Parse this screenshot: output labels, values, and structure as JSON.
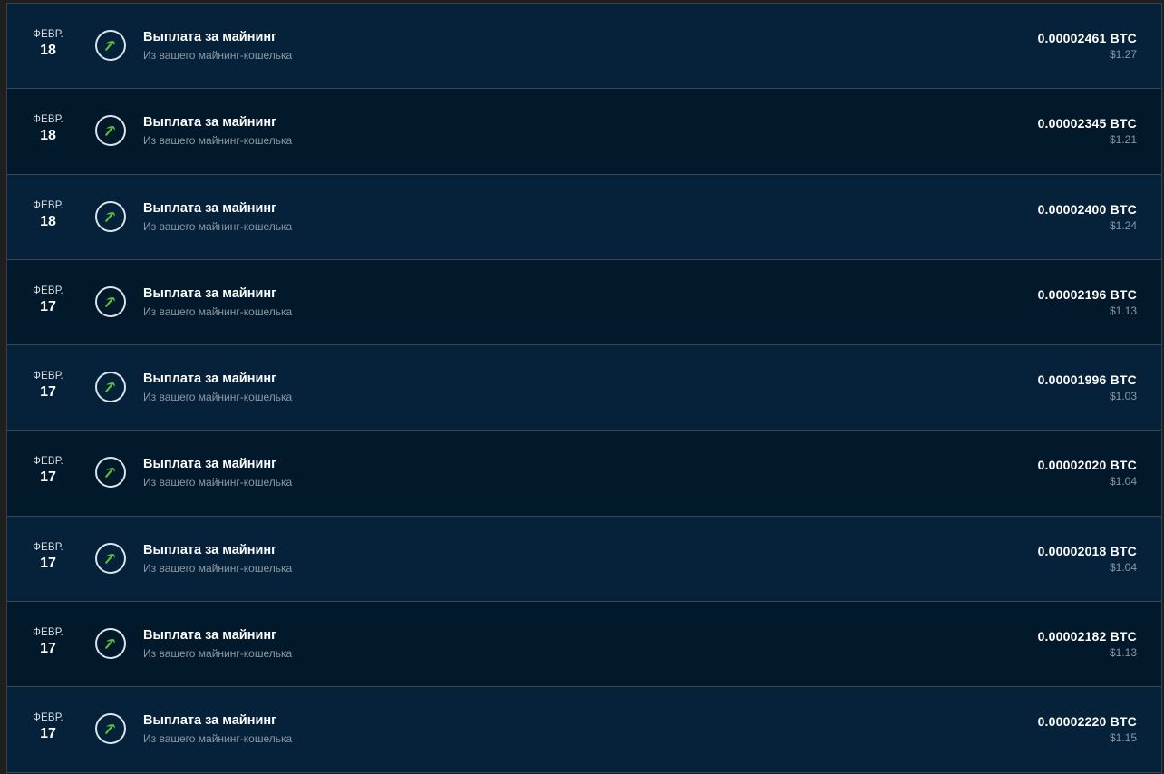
{
  "colors": {
    "row_odd": "#05223a",
    "row_even": "#02182b",
    "icon_accent": "#5fc13b",
    "icon_ring": "#dbe4ea",
    "title_text": "#ffffff",
    "muted_text": "#8c98a3"
  },
  "transactions": [
    {
      "month": "ФЕВР.",
      "day": "18",
      "title": "Выплата за майнинг",
      "subtitle": "Из вашего майнинг-кошелька",
      "btc": "0.00002461 BTC",
      "usd": "$1.27",
      "icon": "pickaxe-icon"
    },
    {
      "month": "ФЕВР.",
      "day": "18",
      "title": "Выплата за майнинг",
      "subtitle": "Из вашего майнинг-кошелька",
      "btc": "0.00002345 BTC",
      "usd": "$1.21",
      "icon": "pickaxe-icon"
    },
    {
      "month": "ФЕВР.",
      "day": "18",
      "title": "Выплата за майнинг",
      "subtitle": "Из вашего майнинг-кошелька",
      "btc": "0.00002400 BTC",
      "usd": "$1.24",
      "icon": "pickaxe-icon"
    },
    {
      "month": "ФЕВР.",
      "day": "17",
      "title": "Выплата за майнинг",
      "subtitle": "Из вашего майнинг-кошелька",
      "btc": "0.00002196 BTC",
      "usd": "$1.13",
      "icon": "pickaxe-icon"
    },
    {
      "month": "ФЕВР.",
      "day": "17",
      "title": "Выплата за майнинг",
      "subtitle": "Из вашего майнинг-кошелька",
      "btc": "0.00001996 BTC",
      "usd": "$1.03",
      "icon": "pickaxe-icon"
    },
    {
      "month": "ФЕВР.",
      "day": "17",
      "title": "Выплата за майнинг",
      "subtitle": "Из вашего майнинг-кошелька",
      "btc": "0.00002020 BTC",
      "usd": "$1.04",
      "icon": "pickaxe-icon"
    },
    {
      "month": "ФЕВР.",
      "day": "17",
      "title": "Выплата за майнинг",
      "subtitle": "Из вашего майнинг-кошелька",
      "btc": "0.00002018 BTC",
      "usd": "$1.04",
      "icon": "pickaxe-icon"
    },
    {
      "month": "ФЕВР.",
      "day": "17",
      "title": "Выплата за майнинг",
      "subtitle": "Из вашего майнинг-кошелька",
      "btc": "0.00002182 BTC",
      "usd": "$1.13",
      "icon": "pickaxe-icon"
    },
    {
      "month": "ФЕВР.",
      "day": "17",
      "title": "Выплата за майнинг",
      "subtitle": "Из вашего майнинг-кошелька",
      "btc": "0.00002220 BTC",
      "usd": "$1.15",
      "icon": "pickaxe-icon"
    }
  ]
}
